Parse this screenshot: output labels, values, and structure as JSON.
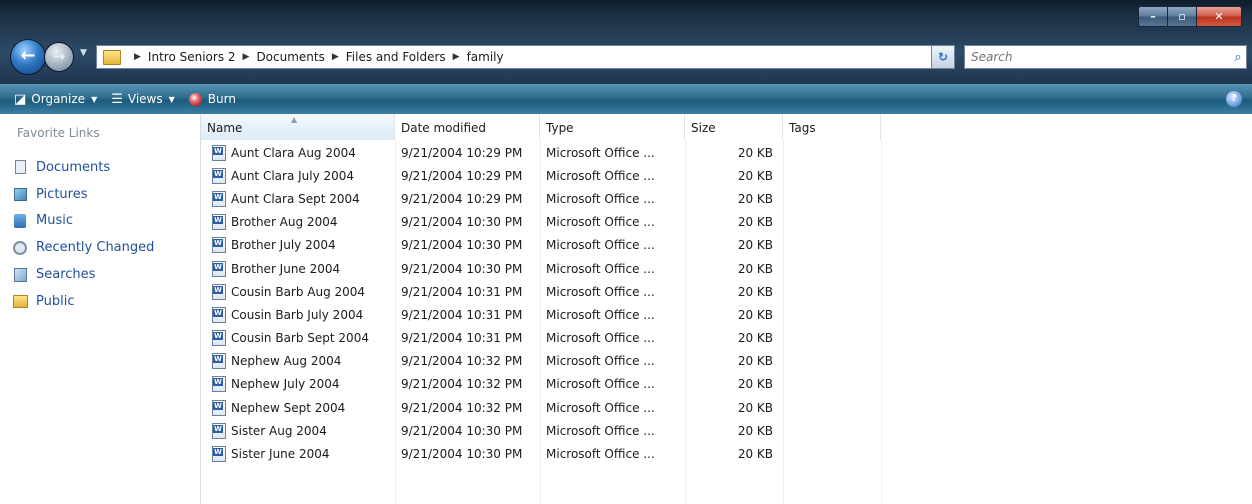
{
  "window": {
    "controls": [
      "minimize",
      "maximize",
      "close"
    ]
  },
  "nav": {
    "breadcrumbs": [
      "Intro Seniors 2",
      "Documents",
      "Files and Folders",
      "family"
    ],
    "search_placeholder": "Search"
  },
  "commandbar": {
    "organize": "Organize",
    "views": "Views",
    "burn": "Burn"
  },
  "navpane": {
    "header": "Favorite Links",
    "items": [
      {
        "label": "Documents",
        "icon": "documents-icon"
      },
      {
        "label": "Pictures",
        "icon": "pictures-icon"
      },
      {
        "label": "Music",
        "icon": "music-icon"
      },
      {
        "label": "Recently Changed",
        "icon": "recently-changed-icon"
      },
      {
        "label": "Searches",
        "icon": "searches-icon"
      },
      {
        "label": "Public",
        "icon": "public-folder-icon"
      }
    ]
  },
  "listview": {
    "columns": [
      "Name",
      "Date modified",
      "Type",
      "Size",
      "Tags"
    ],
    "rows": [
      {
        "name": "Aunt Clara Aug 2004",
        "date": "9/21/2004 10:29 PM",
        "type": "Microsoft Office ...",
        "size": "20 KB"
      },
      {
        "name": "Aunt Clara July 2004",
        "date": "9/21/2004 10:29 PM",
        "type": "Microsoft Office ...",
        "size": "20 KB"
      },
      {
        "name": "Aunt Clara Sept 2004",
        "date": "9/21/2004 10:29 PM",
        "type": "Microsoft Office ...",
        "size": "20 KB"
      },
      {
        "name": "Brother Aug 2004",
        "date": "9/21/2004 10:30 PM",
        "type": "Microsoft Office ...",
        "size": "20 KB"
      },
      {
        "name": "Brother July 2004",
        "date": "9/21/2004 10:30 PM",
        "type": "Microsoft Office ...",
        "size": "20 KB"
      },
      {
        "name": "Brother June 2004",
        "date": "9/21/2004 10:30 PM",
        "type": "Microsoft Office ...",
        "size": "20 KB"
      },
      {
        "name": "Cousin Barb Aug 2004",
        "date": "9/21/2004 10:31 PM",
        "type": "Microsoft Office ...",
        "size": "20 KB"
      },
      {
        "name": "Cousin Barb July 2004",
        "date": "9/21/2004 10:31 PM",
        "type": "Microsoft Office ...",
        "size": "20 KB"
      },
      {
        "name": "Cousin Barb Sept 2004",
        "date": "9/21/2004 10:31 PM",
        "type": "Microsoft Office ...",
        "size": "20 KB"
      },
      {
        "name": "Nephew Aug 2004",
        "date": "9/21/2004 10:32 PM",
        "type": "Microsoft Office ...",
        "size": "20 KB"
      },
      {
        "name": "Nephew July 2004",
        "date": "9/21/2004 10:32 PM",
        "type": "Microsoft Office ...",
        "size": "20 KB"
      },
      {
        "name": "Nephew Sept 2004",
        "date": "9/21/2004 10:32 PM",
        "type": "Microsoft Office ...",
        "size": "20 KB"
      },
      {
        "name": "Sister Aug 2004",
        "date": "9/21/2004 10:30 PM",
        "type": "Microsoft Office ...",
        "size": "20 KB"
      },
      {
        "name": "Sister June 2004",
        "date": "9/21/2004 10:30 PM",
        "type": "Microsoft Office ...",
        "size": "20 KB"
      }
    ]
  },
  "colors": {
    "link_blue": "#1f4f9b",
    "command_bar": "#2f6c8e",
    "titlebar_dark": "#1d3349"
  }
}
